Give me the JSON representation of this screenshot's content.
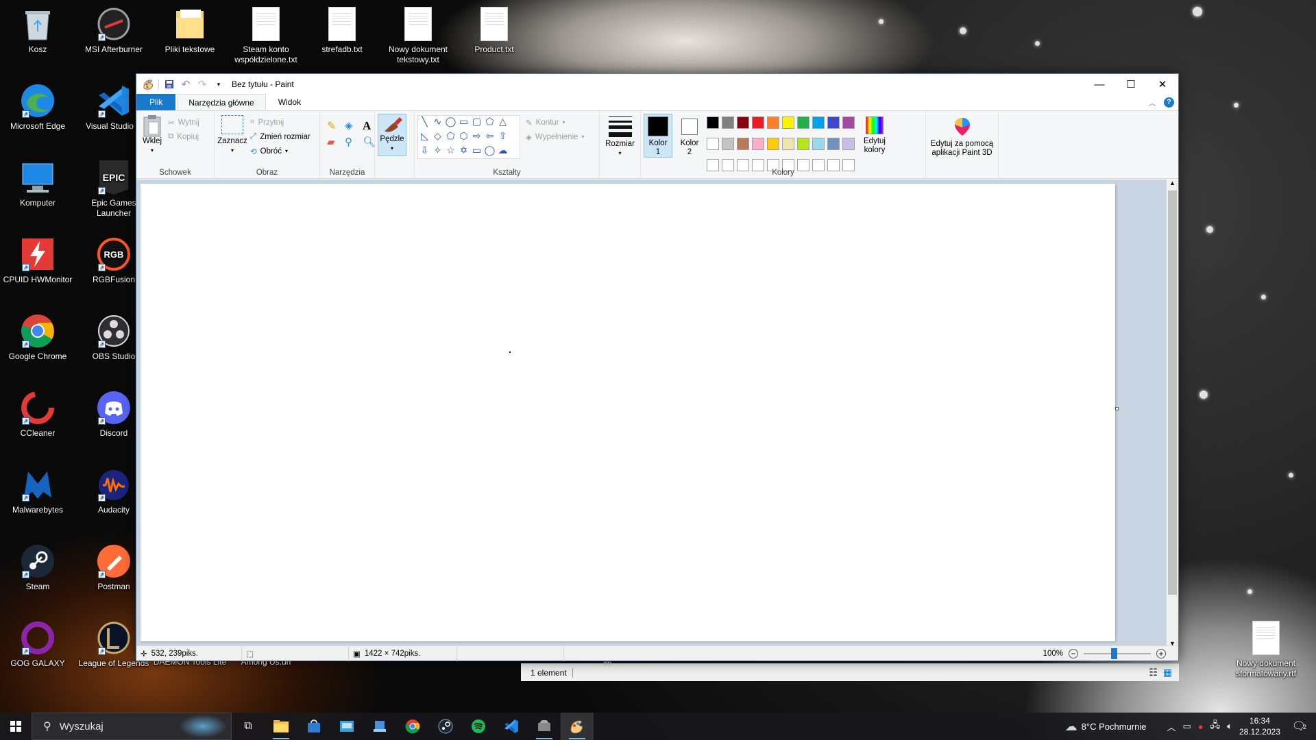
{
  "desktop": {
    "icons": [
      {
        "label": "Kosz"
      },
      {
        "label": "MSI Afterburner"
      },
      {
        "label": "Pliki tekstowe"
      },
      {
        "label": "Steam konto współdzielone.txt"
      },
      {
        "label": "strefadb.txt"
      },
      {
        "label": "Nowy dokument tekstowy.txt"
      },
      {
        "label": "Product.txt"
      },
      {
        "label": "Microsoft Edge"
      },
      {
        "label": "Visual Studio C"
      },
      {
        "label": "Komputer"
      },
      {
        "label": "Epic Games Launcher"
      },
      {
        "label": "CPUID HWMonitor"
      },
      {
        "label": "RGBFusion"
      },
      {
        "label": "Google Chrome"
      },
      {
        "label": "OBS Studio"
      },
      {
        "label": "CCleaner"
      },
      {
        "label": "Discord"
      },
      {
        "label": "Malwarebytes"
      },
      {
        "label": "Audacity"
      },
      {
        "label": "Steam"
      },
      {
        "label": "Postman"
      },
      {
        "label": "GOG GALAXY"
      },
      {
        "label": "League of Legends"
      },
      {
        "label": "DAEMON Tools Lite"
      },
      {
        "label": "Among Us.url"
      },
      {
        "label": "Nowy dokument sformatowany.rtf"
      }
    ]
  },
  "paint": {
    "title": "Bez tytułu - Paint",
    "tabs": [
      "Plik",
      "Narzędzia główne",
      "Widok"
    ],
    "clipboard": {
      "paste": "Wklej",
      "cut": "Wytnij",
      "copy": "Kopiuj",
      "group": "Schowek"
    },
    "image": {
      "select": "Zaznacz",
      "crop": "Przytnij",
      "resize": "Zmień rozmiar",
      "rotate": "Obróć",
      "group": "Obraz"
    },
    "tools": {
      "group": "Narzędzia",
      "text_glyph": "A"
    },
    "brushes": {
      "label": "Pędzle"
    },
    "shapes": {
      "outline": "Kontur",
      "fill": "Wypełnienie",
      "group": "Kształty"
    },
    "size": {
      "label": "Rozmiar"
    },
    "colors": {
      "color1": "Kolor 1",
      "color2": "Kolor 2",
      "edit": "Edytuj kolory",
      "group": "Kolory",
      "color1_value": "#000000",
      "color2_value": "#ffffff",
      "palette_row1": [
        "#000000",
        "#7f7f7f",
        "#880015",
        "#ed1c24",
        "#ff7f27",
        "#fff200",
        "#22b14c",
        "#00a2e8",
        "#3f48cc",
        "#a349a4"
      ],
      "palette_row2": [
        "#ffffff",
        "#c3c3c3",
        "#b97a57",
        "#ffaec9",
        "#ffc90e",
        "#efe4b0",
        "#b5e61d",
        "#99d9ea",
        "#7092be",
        "#c8bfe7"
      ]
    },
    "paint3d": {
      "label": "Edytuj za pomocą aplikacji Paint 3D"
    },
    "status": {
      "cursor": "532, 239piks.",
      "canvas_size": "1422 × 742piks.",
      "zoom": "100%"
    }
  },
  "explorer": {
    "status": "1 element",
    "folder": "lm"
  },
  "taskbar": {
    "search_placeholder": "Wyszukaj",
    "weather": "8°C  Pochmurnie",
    "time": "16:34",
    "date": "28.12.2023",
    "notifications": "2"
  }
}
